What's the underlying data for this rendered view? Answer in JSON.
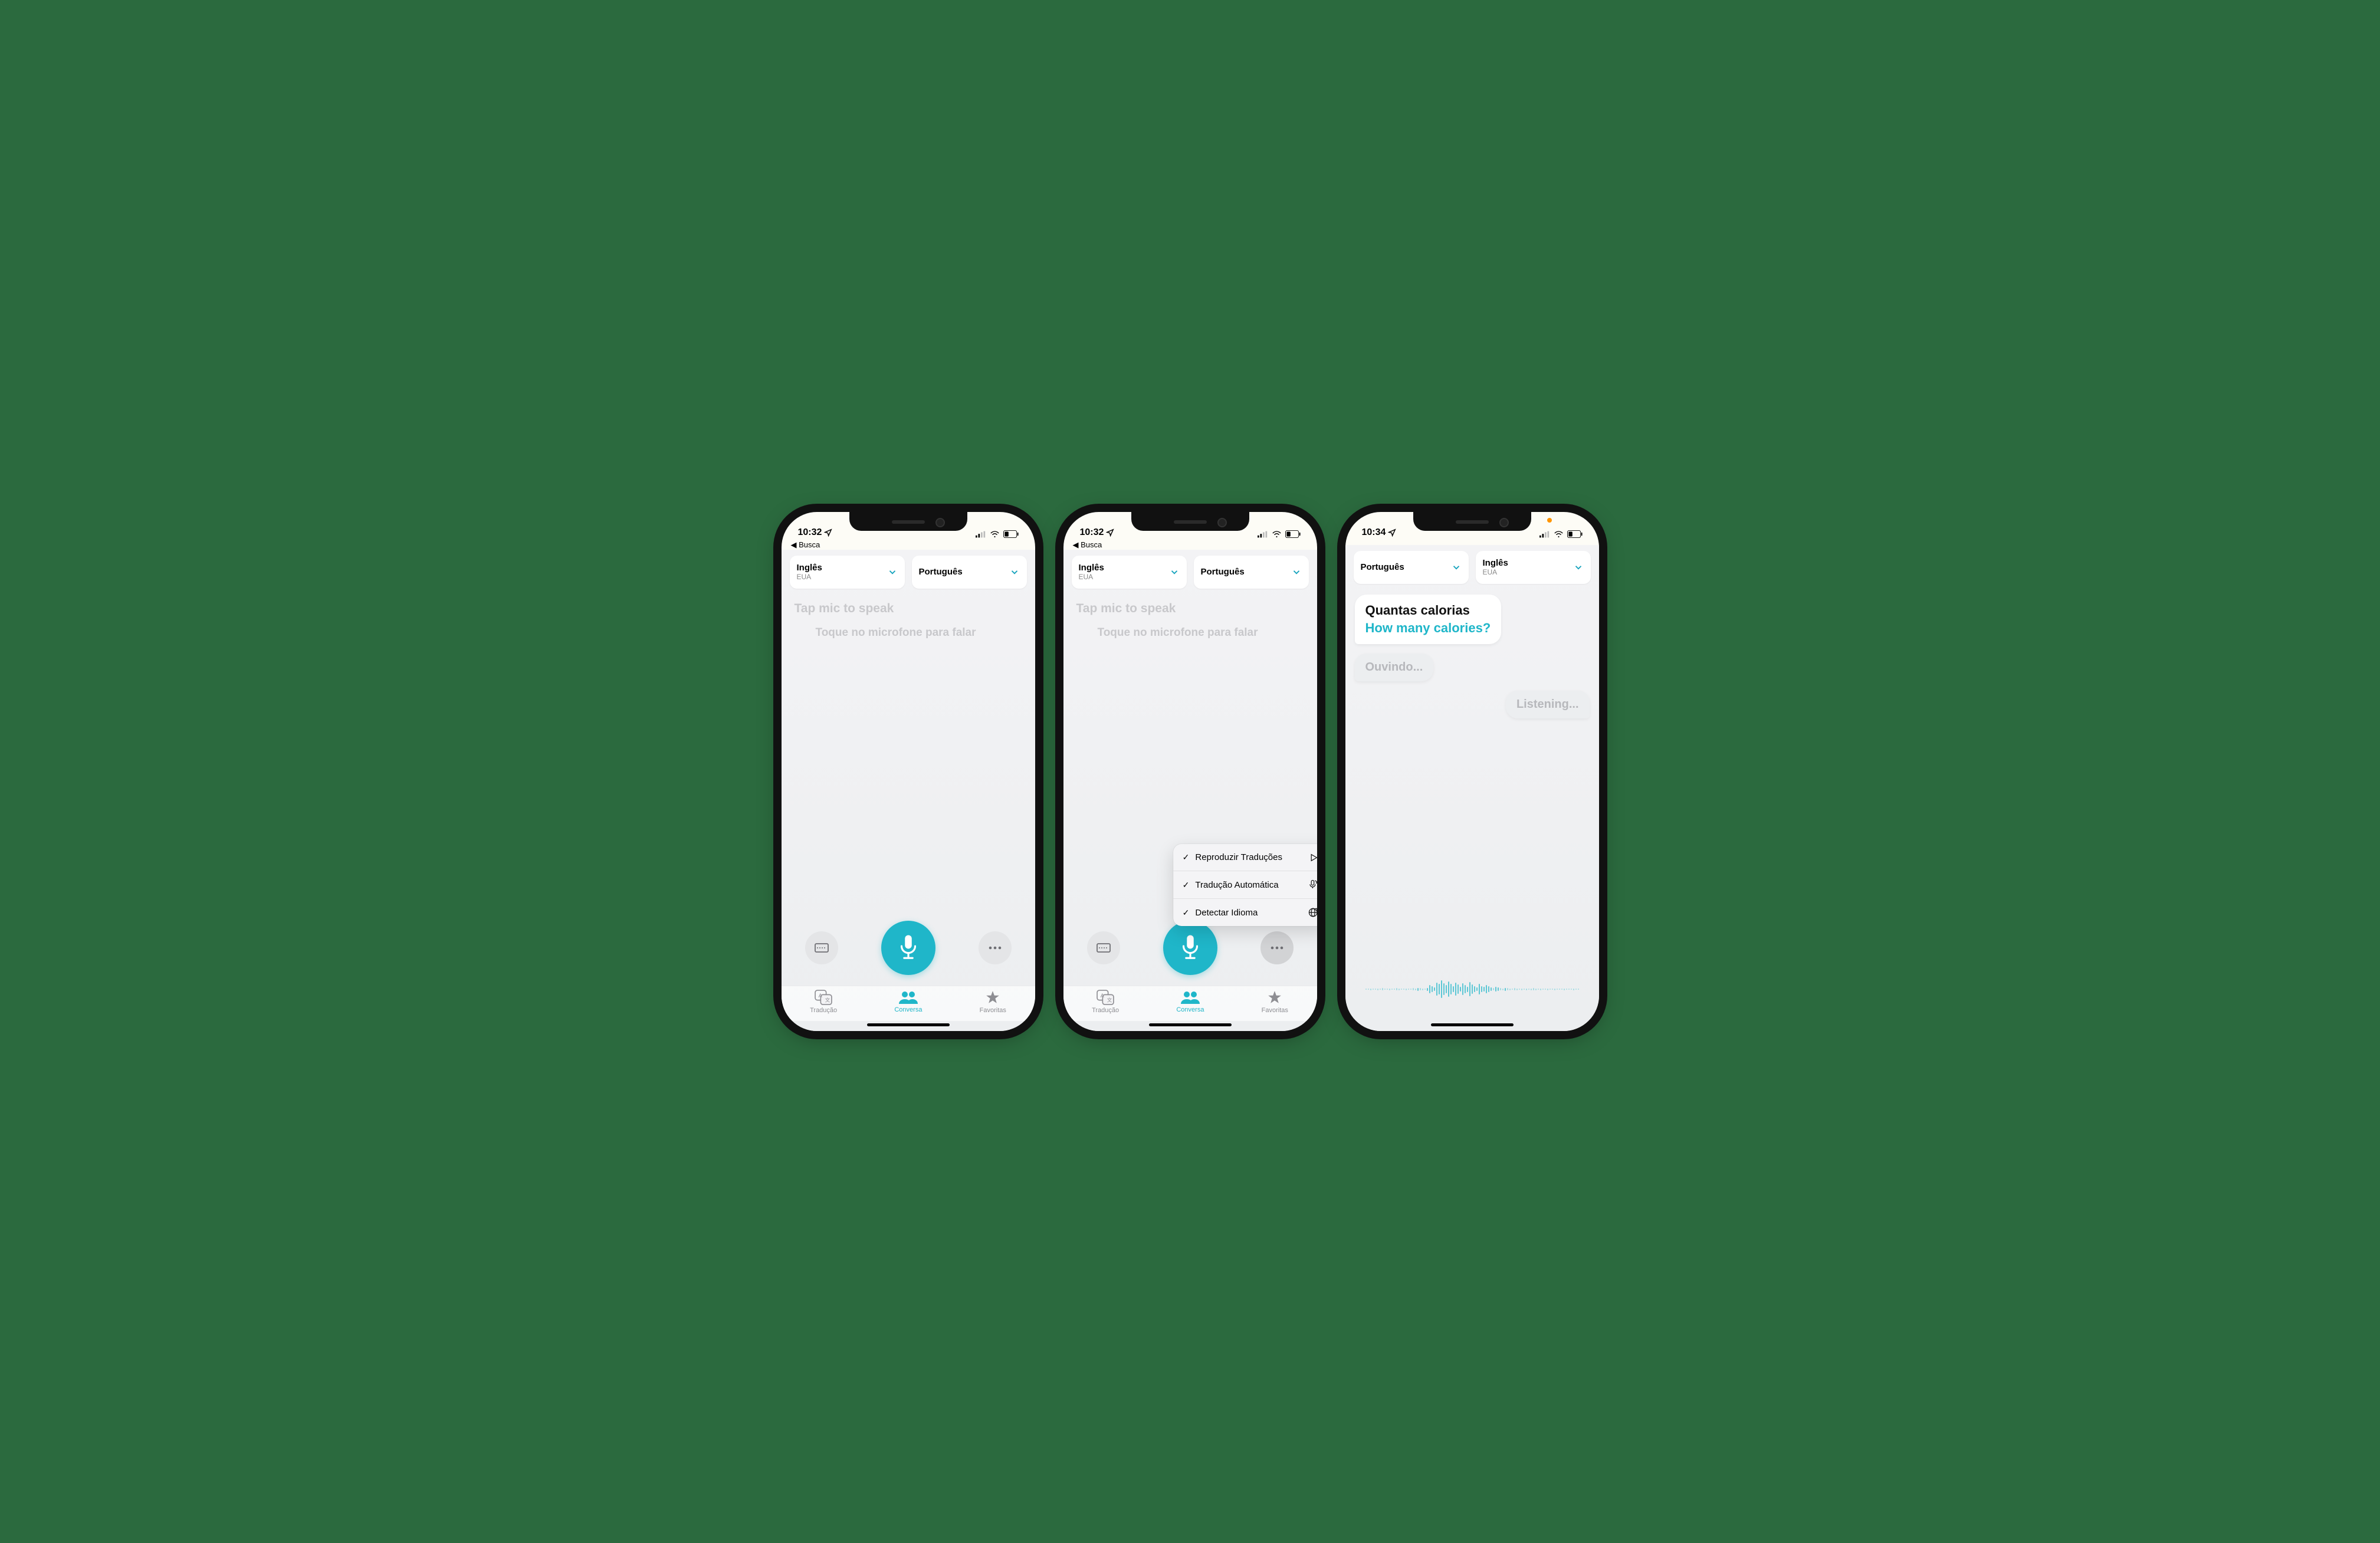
{
  "accent": "#1fb6c9",
  "phones": [
    {
      "time": "10:32",
      "back": "Busca",
      "langA": {
        "name": "Inglês",
        "sub": "EUA"
      },
      "langB": {
        "name": "Português",
        "sub": ""
      },
      "prompt1": "Tap mic to speak",
      "prompt2": "Toque no microfone para falar",
      "tabs": {
        "t1": "Tradução",
        "t2": "Conversa",
        "t3": "Favoritas",
        "active": 1
      }
    },
    {
      "time": "10:32",
      "back": "Busca",
      "langA": {
        "name": "Inglês",
        "sub": "EUA"
      },
      "langB": {
        "name": "Português",
        "sub": ""
      },
      "prompt1": "Tap mic to speak",
      "prompt2": "Toque no microfone para falar",
      "tabs": {
        "t1": "Tradução",
        "t2": "Conversa",
        "t3": "Favoritas",
        "active": 1
      },
      "menu": [
        {
          "label": "Reproduzir Traduções",
          "icon": "play"
        },
        {
          "label": "Tradução Automática",
          "icon": "mic-auto"
        },
        {
          "label": "Detectar Idioma",
          "icon": "globe"
        }
      ]
    },
    {
      "time": "10:34",
      "langA": {
        "name": "Português",
        "sub": ""
      },
      "langB": {
        "name": "Inglês",
        "sub": "EUA"
      },
      "result": {
        "original": "Quantas calorias",
        "translated": "How many calories?"
      },
      "listenLeft": "Ouvindo...",
      "listenRight": "Listening..."
    }
  ]
}
